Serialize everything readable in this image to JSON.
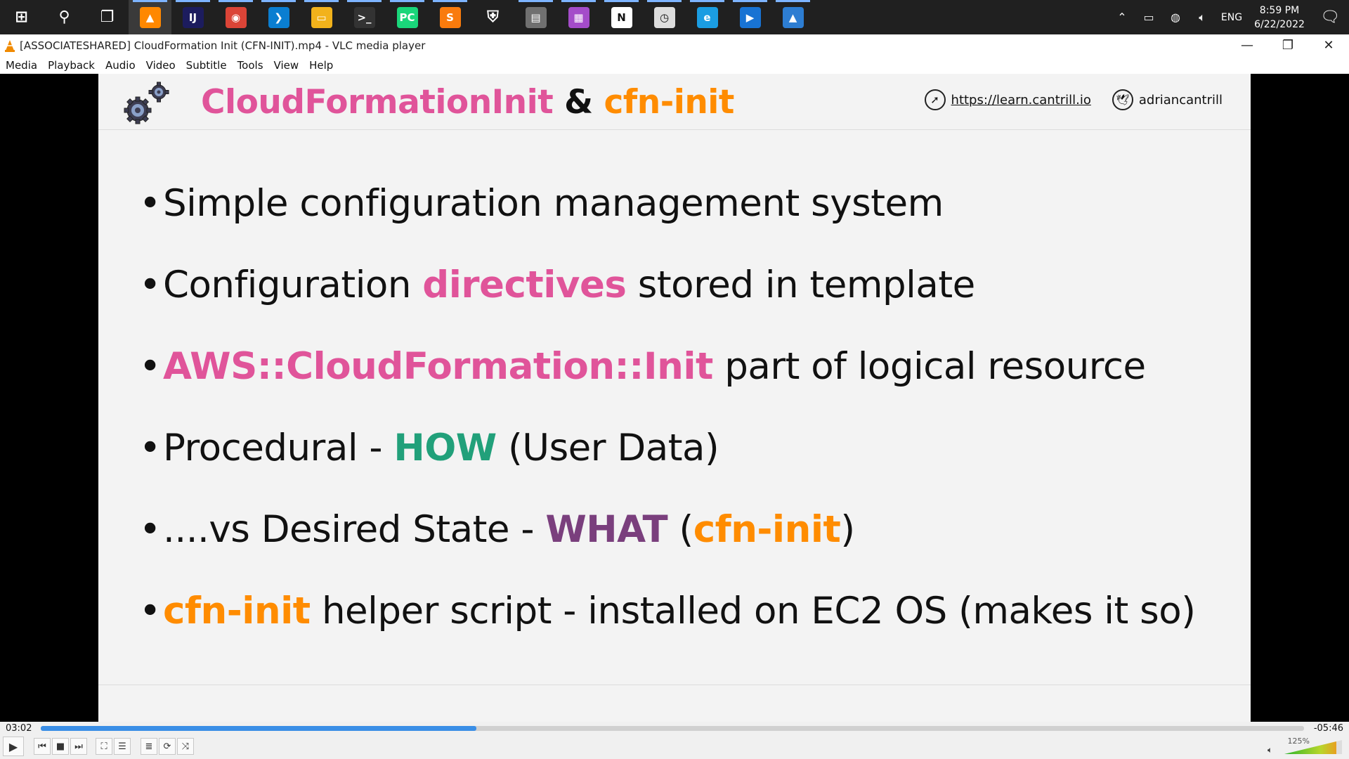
{
  "taskbar": {
    "apps": [
      {
        "name": "start",
        "glyph": "⊞",
        "color": "#202020"
      },
      {
        "name": "search",
        "glyph": "⚲",
        "color": "#202020"
      },
      {
        "name": "task-view",
        "glyph": "❐",
        "color": "#202020"
      },
      {
        "name": "vlc",
        "glyph": "▲",
        "color": "#ff8800"
      },
      {
        "name": "intellij",
        "glyph": "IJ",
        "color": "#1c1c5e"
      },
      {
        "name": "chrome",
        "glyph": "◉",
        "color": "#db4437"
      },
      {
        "name": "vscode",
        "glyph": "❯",
        "color": "#0a7ed1"
      },
      {
        "name": "file-explorer",
        "glyph": "▭",
        "color": "#f2b21b"
      },
      {
        "name": "terminal",
        "glyph": ">_",
        "color": "#333333"
      },
      {
        "name": "pycharm",
        "glyph": "PC",
        "color": "#1ad67a"
      },
      {
        "name": "sublime",
        "glyph": "S",
        "color": "#f97b0d"
      },
      {
        "name": "security",
        "glyph": "⛨",
        "color": "#202020"
      },
      {
        "name": "app-drive",
        "glyph": "▤",
        "color": "#707070"
      },
      {
        "name": "app-multicolor",
        "glyph": "▦",
        "color": "#a44cc9"
      },
      {
        "name": "notion",
        "glyph": "N",
        "color": "#ffffff"
      },
      {
        "name": "clock-app",
        "glyph": "◷",
        "color": "#dddddd"
      },
      {
        "name": "edge",
        "glyph": "e",
        "color": "#1b9de2"
      },
      {
        "name": "media-player",
        "glyph": "▶",
        "color": "#1873d3"
      },
      {
        "name": "photos",
        "glyph": "▲",
        "color": "#2d7dd2"
      }
    ],
    "tray": {
      "language": "ENG",
      "time": "8:59 PM",
      "date": "6/22/2022"
    }
  },
  "window": {
    "title": "[ASSOCIATESHARED] CloudFormation Init (CFN-INIT).mp4 - VLC media player",
    "minimize": "—",
    "restore": "❐",
    "close": "✕"
  },
  "menu": [
    "Media",
    "Playback",
    "Audio",
    "Video",
    "Subtitle",
    "Tools",
    "View",
    "Help"
  ],
  "slide": {
    "title_part1": "CloudFormationInit",
    "title_amp": " & ",
    "title_part2": "cfn-init",
    "url": "https://learn.cantrill.io",
    "twitter": "adriancantrill",
    "bullets": [
      {
        "pre": "Simple configuration management system",
        "hl": "",
        "post": ""
      },
      {
        "pre": "Configuration ",
        "hl": "directives",
        "post": " stored in template"
      },
      {
        "pre": "",
        "hl": "AWS::CloudFormation::Init",
        "post": " part of logical resource"
      },
      {
        "pre": "Procedural - ",
        "hl": "HOW",
        "post": " (User Data)"
      },
      {
        "pre": "....vs Desired State - ",
        "hl": "WHAT",
        "post": " (",
        "hl2": "cfn-init",
        "post2": ")"
      },
      {
        "pre": "",
        "hl": "cfn-init",
        "post": " helper script - installed on EC2 OS (makes it so)"
      }
    ]
  },
  "player": {
    "elapsed": "03:02",
    "remaining": "-05:46",
    "progress_fraction": 0.345,
    "volume": "125%"
  },
  "colors": {
    "pink": "#e0549a",
    "orange": "#ff8c00",
    "green": "#21a07a",
    "purple": "#7a3f7d",
    "seek": "#3a8ee6"
  }
}
